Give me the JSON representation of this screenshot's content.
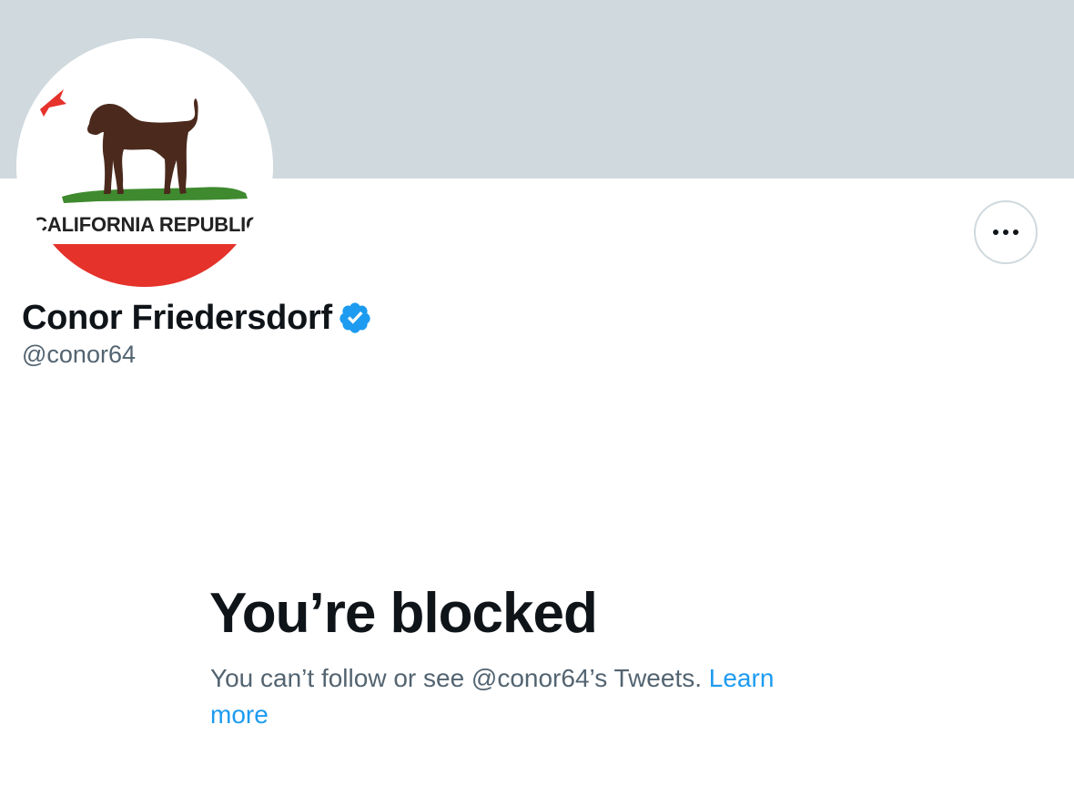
{
  "profile": {
    "avatar_text": "CALIFORNIA REPUBLIC",
    "display_name": "Conor Friedersdorf",
    "handle": "@conor64",
    "verified": true,
    "more_icon": "more-horizontal-icon"
  },
  "blocked": {
    "title": "You’re blocked",
    "message": "You can’t follow or see @conor64’s Tweets.",
    "link_label": "Learn more"
  },
  "colors": {
    "banner": "#cfd9de",
    "text_primary": "#0f1419",
    "text_secondary": "#536471",
    "link": "#1d9bf0",
    "verified": "#1d9bf0",
    "flag_red": "#e5322b",
    "flag_green": "#3f8a2f",
    "bear_brown": "#4b2a1d"
  }
}
